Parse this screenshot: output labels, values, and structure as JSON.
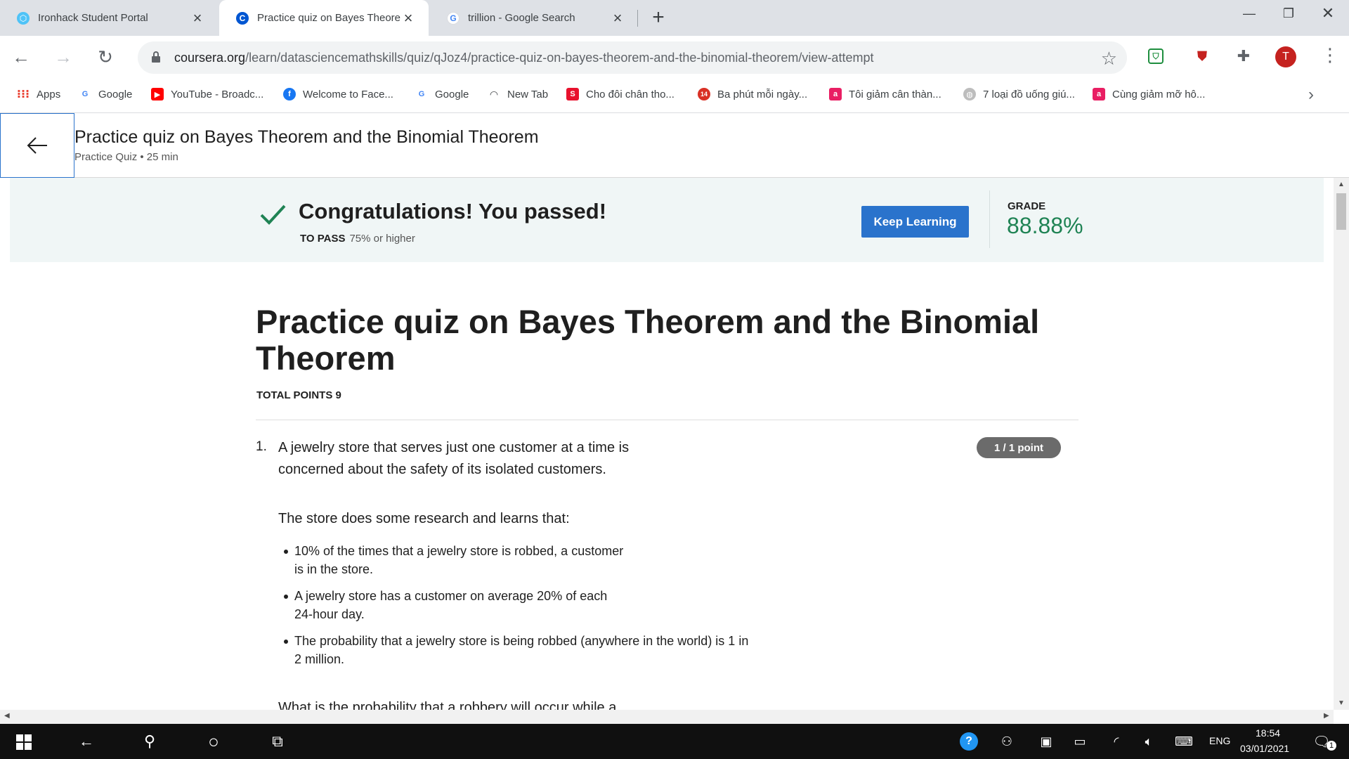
{
  "browser": {
    "tabs": [
      {
        "title": "Ironhack Student Portal",
        "favicon": "ironhack-icon",
        "active": false
      },
      {
        "title": "Practice quiz on Bayes Theorem",
        "favicon": "coursera-icon",
        "active": true
      },
      {
        "title": "trillion - Google Search",
        "favicon": "google-icon",
        "active": false
      }
    ],
    "url_host": "coursera.org",
    "url_path": "/learn/datasciencemathskills/quiz/qJoz4/practice-quiz-on-bayes-theorem-and-the-binomial-theorem/view-attempt",
    "profile_initial": "T",
    "bookmarks": [
      {
        "label": "Apps",
        "icon": "apps-grid-icon"
      },
      {
        "label": "Google",
        "icon": "google-icon"
      },
      {
        "label": "YouTube - Broadc...",
        "icon": "youtube-icon"
      },
      {
        "label": "Welcome to Face...",
        "icon": "facebook-icon"
      },
      {
        "label": "Google",
        "icon": "google-icon"
      },
      {
        "label": "New Tab",
        "icon": "newtab-icon"
      },
      {
        "label": "Cho đôi chân tho...",
        "icon": "s-icon"
      },
      {
        "label": "Ba phút mỗi ngày...",
        "icon": "news14-icon"
      },
      {
        "label": "Tôi giảm cân thàn...",
        "icon": "a-icon"
      },
      {
        "label": "7 loại đồ uống giú...",
        "icon": "globe-icon"
      },
      {
        "label": "Cùng giảm mỡ hô...",
        "icon": "a-icon"
      }
    ]
  },
  "header": {
    "title": "Practice quiz on Bayes Theorem and the Binomial Theorem",
    "subtitle": "Practice Quiz • 25 min"
  },
  "banner": {
    "message": "Congratulations! You passed!",
    "to_pass_label": "TO PASS",
    "to_pass_value": "75% or higher",
    "button_label": "Keep Learning",
    "grade_label": "GRADE",
    "grade_value": "88.88%"
  },
  "quiz": {
    "title": "Practice quiz on Bayes Theorem and the Binomial Theorem",
    "total_points": "TOTAL POINTS 9",
    "question_number": "1.",
    "question_line1": "A jewelry store that serves just one customer at a time is",
    "question_line2": "concerned about the safety of its isolated customers.",
    "points_badge": "1 / 1 point",
    "research_intro": "The store does some research and learns that:",
    "bullets": [
      {
        "l1": "10% of the times that a jewelry store is robbed, a customer",
        "l2": "is in the store."
      },
      {
        "l1": "A jewelry store has a customer on average 20% of each",
        "l2": "24-hour day."
      },
      {
        "l1": "The probability that a jewelry store is being robbed (anywhere in the world) is 1 in",
        "l2": "2 million."
      }
    ],
    "next_line_partial": "What is the probability that a robbery will occur while a"
  },
  "taskbar": {
    "lang": "ENG",
    "time": "18:54",
    "date": "03/01/2021",
    "notification_count": "1"
  },
  "colors": {
    "accent": "#2a73cc",
    "success": "#1f8354",
    "banner_bg": "#f0f6f6"
  }
}
